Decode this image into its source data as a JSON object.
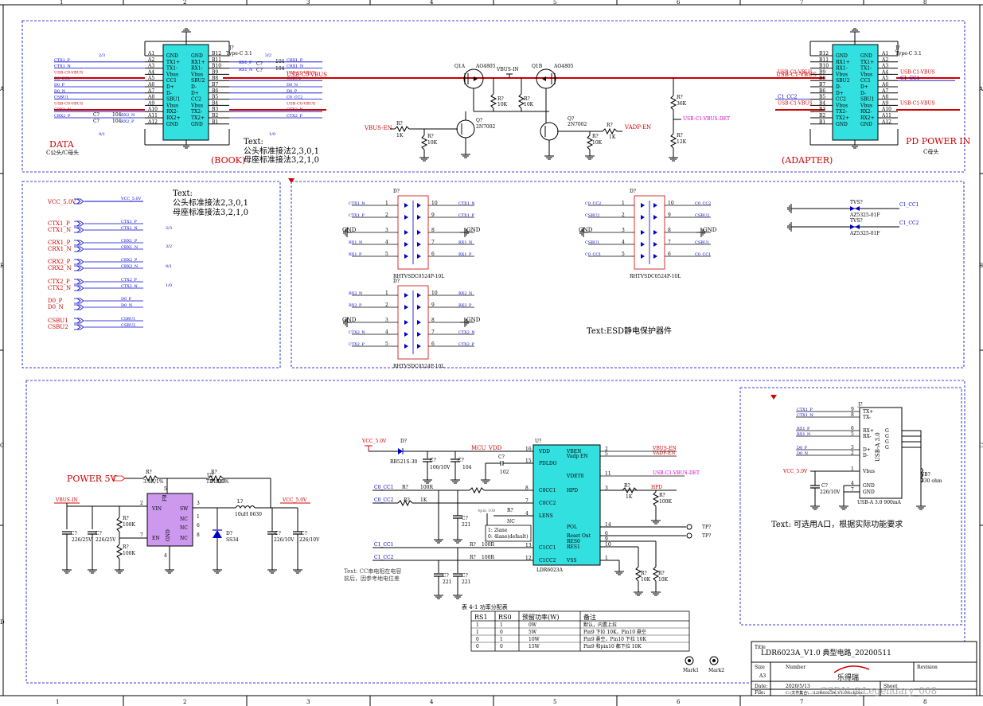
{
  "frame": {
    "cols": [
      "1",
      "2",
      "3",
      "4",
      "5",
      "6",
      "7",
      "8"
    ],
    "rows": [
      "A",
      "B",
      "C",
      "D"
    ]
  },
  "top": {
    "j1": {
      "ref": "J?",
      "type": "Type-C 3.1",
      "left_pins": [
        "A1",
        "A2",
        "A3",
        "A4",
        "A5",
        "A6",
        "A7",
        "A8",
        "A9",
        "A10",
        "A11",
        "A12"
      ],
      "right_pins": [
        "B12",
        "B11",
        "B10",
        "B9",
        "B8",
        "B7",
        "B6",
        "B5",
        "B4",
        "B3",
        "B2",
        "B1"
      ],
      "left_names": [
        "GND",
        "TX1+",
        "TX1-",
        "Vbus",
        "CC1",
        "D+",
        "D-",
        "SBU1",
        "Vbus",
        "RX2-",
        "RX2+",
        "GND"
      ],
      "right_names": [
        "GND",
        "RX1+",
        "RX1-",
        "Vbus",
        "SBU2",
        "D-",
        "D+",
        "CC2",
        "Vbus",
        "TX2-",
        "TX2+",
        "GND"
      ],
      "left_nets": [
        "",
        "CTX1_P",
        "CTX1_N",
        "USB-C0-VBUS",
        "C0_CC1",
        "D0_P",
        "D0_N",
        "CSBU1",
        "USB-C0-VBUS",
        "CRX2_N",
        "CRX2_P",
        ""
      ],
      "right_nets": [
        "",
        "CRX1_P",
        "CRX1_N",
        "USB-C0-VBUS",
        "CSBU2",
        "D0_N",
        "D0_P",
        "C0_CC2",
        "USB-C0-VBUS",
        "CTX2_N",
        "CTX2_P",
        ""
      ],
      "group_labels": [
        "2/3",
        "0/1",
        "3/2",
        "1/0"
      ],
      "caps": [
        "C?",
        "104",
        "C?",
        "104",
        "C?",
        "104",
        "C?",
        "104"
      ],
      "cap_nets": [
        "RX1_P",
        "RX1_N",
        "RX2_N",
        "RX2_P"
      ],
      "section_title": "DATA",
      "section_sub": "C公头/C母头",
      "text": "Text:",
      "text_line1": "公头标准接法2,3,0,1",
      "text_line2": "母座标准接法3,2,1,0",
      "tag": "(BOOK)"
    },
    "mosfets": {
      "q1a": "Q1A",
      "q1a_part": "AO4805",
      "q1b": "Q1B",
      "q1b_part": "AO4805",
      "vbus_in": "VBUS-IN",
      "r_left": "R?",
      "r_left_val": "10K",
      "r_mid": "R?",
      "r_mid_val": "10K",
      "q_left": "Q?",
      "q_left_part": "2N7002",
      "q_right": "Q?",
      "q_right_part": "2N7002",
      "vbus_en": "VBUS-EN",
      "r_en": "R?",
      "r_en_val": "1K",
      "r_pd1": "R?",
      "r_pd1_val": "10K",
      "r_pd2": "R?",
      "r_pd2_val": "10K",
      "vadp_en": "VADP-EN",
      "r_vadp": "R?",
      "r_vadp_val": "1K",
      "r_36k": "R?",
      "r_36k_val": "36K",
      "det": "USB-C1-VBUS-DET",
      "r_12k": "R?",
      "r_12k_val": "12K",
      "vbus_c0": "USB-C0-VBUS",
      "vbus_c1": "USB-C1-VBUS"
    },
    "j2": {
      "ref": "J?",
      "type": "Type-C 3.1",
      "left_pins": [
        "B12",
        "B11",
        "B10",
        "B9",
        "B8",
        "B7",
        "B6",
        "B5",
        "B4",
        "B3",
        "B2",
        "B1"
      ],
      "right_pins": [
        "A1",
        "A2",
        "A3",
        "A4",
        "A5",
        "A6",
        "A7",
        "A8",
        "A9",
        "A10",
        "A11",
        "A12"
      ],
      "left_names": [
        "GND",
        "RX1+",
        "RX1-",
        "Vbus",
        "SBU2",
        "D-",
        "D+",
        "CC2",
        "Vbus",
        "TX2-",
        "TX2+",
        "GND"
      ],
      "right_names": [
        "GND",
        "TX1+",
        "TX1-",
        "Vbus",
        "CC1",
        "D+",
        "D-",
        "SBU1",
        "Vbus",
        "RX2-",
        "RX2+",
        "GND"
      ],
      "left_nets": [
        "",
        "",
        "",
        "USB-C1-VBUS",
        "",
        "",
        "",
        "C1_CC2",
        "USB-C1-VBUS",
        "",
        "",
        ""
      ],
      "right_nets": [
        "",
        "",
        "",
        "USB-C1-VBUS",
        "C1_CC1",
        "",
        "",
        "",
        "USB-C1-VBUS",
        "",
        "",
        ""
      ],
      "title": "PD POWER IN",
      "sub": "C母头",
      "tag": "(ADAPTER)"
    }
  },
  "netlist": {
    "vcc": "VCC_5.0V",
    "items": [
      {
        "port": "CTX1_P",
        "net": "CTX1_P"
      },
      {
        "port": "CTX1_N",
        "net": "CTX1_N"
      },
      {
        "port": "CRX1_P",
        "net": "CRX1_P"
      },
      {
        "port": "CRX1_N",
        "net": "CRX1_N"
      },
      {
        "port": "CRX2_P",
        "net": "CRX2_P"
      },
      {
        "port": "CRX2_N",
        "net": "CRX2_N"
      },
      {
        "port": "CTX2_P",
        "net": "CTX2_P"
      },
      {
        "port": "CTX2_N",
        "net": "CTX2_N"
      },
      {
        "port": "D0_P",
        "net": "D0_P"
      },
      {
        "port": "D0_N",
        "net": "D0_N"
      },
      {
        "port": "CSBU1",
        "net": "CSBU1"
      },
      {
        "port": "CSBU2",
        "net": "CSBU2"
      }
    ],
    "group_labels": [
      "2/3",
      "3/2",
      "0/1",
      "1/0"
    ],
    "text": "Text:",
    "text_line1": "公头标准接法2,3,0,1",
    "text_line2": "母座标准接法3,2,1,0"
  },
  "esd": {
    "parts": [
      {
        "ref": "D?",
        "part": "RHTVSDC0524P-10L",
        "nets": [
          "CTX1_N",
          "CTX1_P",
          "GND",
          "RX1_N",
          "RX1_P"
        ],
        "right_nets": [
          "CTX1_N",
          "CTX1_P",
          "GND",
          "RX1_N",
          "RX1_P"
        ]
      },
      {
        "ref": "D?",
        "part": "RHTVSDC0524P-10L",
        "nets": [
          "RX2_N",
          "RX2_P",
          "GND",
          "CTX2_N",
          "CTX2_P"
        ],
        "right_nets": [
          "RX2_N",
          "RX2_P",
          "GND",
          "CTX2_N",
          "CTX2_P"
        ]
      },
      {
        "ref": "D?",
        "part": "RHTVSDC0524P-10L",
        "nets": [
          "C0_CC2",
          "CSBU2",
          "GND",
          "CSBU1",
          "C0_CC1"
        ],
        "right_nets": [
          "C0_CC2",
          "CSBU2",
          "GND",
          "CSBU1",
          "C0_CC1"
        ]
      }
    ],
    "left_pins": [
      "1",
      "2",
      "3",
      "4",
      "5"
    ],
    "right_pins": [
      "10",
      "9",
      "8",
      "7",
      "6"
    ],
    "tvs": [
      {
        "ref": "TVS?",
        "part": "AZ5325-01F",
        "net": "C1_CC1"
      },
      {
        "ref": "TVS?",
        "part": "AZ5325-01F",
        "net": "C1_CC2"
      }
    ],
    "text": "Text:ESD静电保护器件"
  },
  "power": {
    "title": "POWER 5V",
    "vbus_in": "VBUS-IN",
    "u_ref": "U?",
    "u_part": "TD1583",
    "pins": [
      "VIN",
      "SW",
      "NC",
      "NC",
      "EN",
      "NC",
      "FB",
      "GND"
    ],
    "pin_nums": [
      "2",
      "3",
      "1",
      "6",
      "7",
      "8",
      "5",
      "4"
    ],
    "r1": "R?",
    "r1_val": "3.4K/1%",
    "r2": "R?",
    "r2_val": "11K/1%",
    "l1": "L?",
    "l1_val": "10uH 0630",
    "d1": "D?",
    "d1_val": "SS34",
    "vcc": "VCC_5.0V",
    "c_in1": "C?",
    "c_in1_val": "226/25V",
    "c_in2": "C?",
    "c_in2_val": "226/25V",
    "r_en1": "R?",
    "r_en1_val": "100K",
    "r_en2": "R?",
    "r_en2_val": "100K",
    "c_out1": "C?",
    "c_out1_val": "226/10V",
    "c_out2": "C?",
    "c_out2_val": "226/10V"
  },
  "controller": {
    "vcc": "VCC_5.0V",
    "d_ref": "D?",
    "d_part": "RB521S-30",
    "mcu_vdd": "MCU_VDD",
    "c1": "C?",
    "c1_val": "106/10V",
    "c2": "C?",
    "c2_val": "104",
    "c3": "C?",
    "c3_val": "102",
    "u_ref": "U?",
    "u_part": "LDR6023A",
    "left_pins": [
      {
        "num": "16",
        "name": "VDD"
      },
      {
        "num": "15",
        "name": "PDLDO"
      },
      {
        "num": "8",
        "name": "C0CC1"
      },
      {
        "num": "7",
        "name": "C0CC2"
      },
      {
        "num": "4",
        "name": "LENS"
      },
      {
        "num": "13",
        "name": "C1CC1"
      },
      {
        "num": "12",
        "name": "C1CC2"
      }
    ],
    "right_pins": [
      {
        "num": "2",
        "name": "VBEN",
        "net": "VBUS-EN"
      },
      {
        "num": "5",
        "name": "Vadp EN",
        "net": "VADP-EN"
      },
      {
        "num": "11",
        "name": "VDET0",
        "net": "USB-C1-VBUS-DET"
      },
      {
        "num": "3",
        "name": "HPD",
        "net": "HPD"
      },
      {
        "num": "14",
        "name": "POL",
        "net": "TP?"
      },
      {
        "num": "6",
        "name": "Reset Out",
        "net": "TP?"
      },
      {
        "num": "9",
        "name": "RES0",
        "net": ""
      },
      {
        "num": "10",
        "name": "RES1",
        "net": ""
      },
      {
        "num": "1",
        "name": "VSS",
        "net": ""
      }
    ],
    "cc_nets": [
      "C0_CC1",
      "C0_CC2",
      "C1_CC1",
      "C1_CC2"
    ],
    "r_cc1": "R?",
    "r_cc1_val": "100R",
    "r_cc2": "R?",
    "r_cc2_val": "1K",
    "r_cc3": "R?",
    "r_cc3_val": "100R",
    "r_cc4": "R?",
    "r_cc4_val": "100R",
    "c_cc1": "C?",
    "c_cc1_val": "221",
    "c_cc2": "C?",
    "c_cc2_val": "221",
    "c_cc3": "C?",
    "c_cc3_val": "221",
    "lens_note": "4pin 108",
    "lens_r": "R?",
    "lens_nc": "NC",
    "lens_box": [
      "1: 2lane",
      "0: 4lane(default)"
    ],
    "r_hpd": "R?",
    "r_hpd_val": "1K",
    "r_hpd2": "R?",
    "r_hpd2_val": "100K",
    "r_res0": "R?",
    "r_res0_val": "10K",
    "r_res1": "R?",
    "r_res1_val": "10K",
    "note_line1": "Text: CC串电阻在电容",
    "note_line2": "前后，因参考地电位差",
    "table": {
      "title": "表 4-1 功率分配表",
      "headers": [
        "RS1",
        "RS0",
        "预留功率(W)",
        "备注"
      ],
      "rows": [
        [
          "1",
          "1",
          "0W",
          "默认，内置上拉"
        ],
        [
          "1",
          "0",
          "5W",
          "Pin9 下拉 10K，Pin10 悬空"
        ],
        [
          "0",
          "1",
          "10W",
          "Pin9 悬空，Pin10 下拉 10K"
        ],
        [
          "0",
          "0",
          "15W",
          "Pin9 和pin10 都下拉 10K"
        ]
      ]
    },
    "marks": [
      "Mark1",
      "Mark2"
    ]
  },
  "usba": {
    "ref": "J?",
    "type": "USB-A 3.0",
    "part": "USB-A 3.0 900mA",
    "nets": [
      "CTX1_P",
      "CTX1_N",
      "RX1_P",
      "RX1_N",
      "D0_P",
      "D0_N"
    ],
    "pin_nums": [
      "9",
      "8",
      "6",
      "5",
      "3",
      "2",
      "1",
      "4",
      "7"
    ],
    "pin_names": [
      "TX+",
      "TX-",
      "RX+",
      "RX-",
      "D+",
      "D-",
      "Vbus",
      "GND",
      "GND"
    ],
    "g_labels": [
      "G",
      "G",
      "G",
      "G"
    ],
    "vcc": "VCC_5.0V",
    "c": "C?",
    "c_val": "226/10V",
    "fb": "FB?",
    "fb_val": "330 ohm",
    "text": "Text: 可选用A口，根据实际功能要求"
  },
  "title_block": {
    "title_label": "Title",
    "title": "LDR6023A_V1.0  典型电路_20200511",
    "size_label": "Size",
    "size": "A3",
    "number_label": "Number",
    "revision_label": "Revision",
    "logo": "乐得瑞",
    "date_label": "Date:",
    "date": "2020/5/13",
    "file_label": "File:",
    "file": "C:\\文件集合\\...\\LDR6023A_V1.0.SchDoc",
    "sheet_label": "Sheet",
    "watermark": "CSDN @Legendary_008"
  },
  "colors": {
    "wire": "#0000cc",
    "power": "#cc0000",
    "chip_fill": "#33e0e0",
    "pwr_chip": "#cc99ee",
    "frame": "#000000"
  }
}
